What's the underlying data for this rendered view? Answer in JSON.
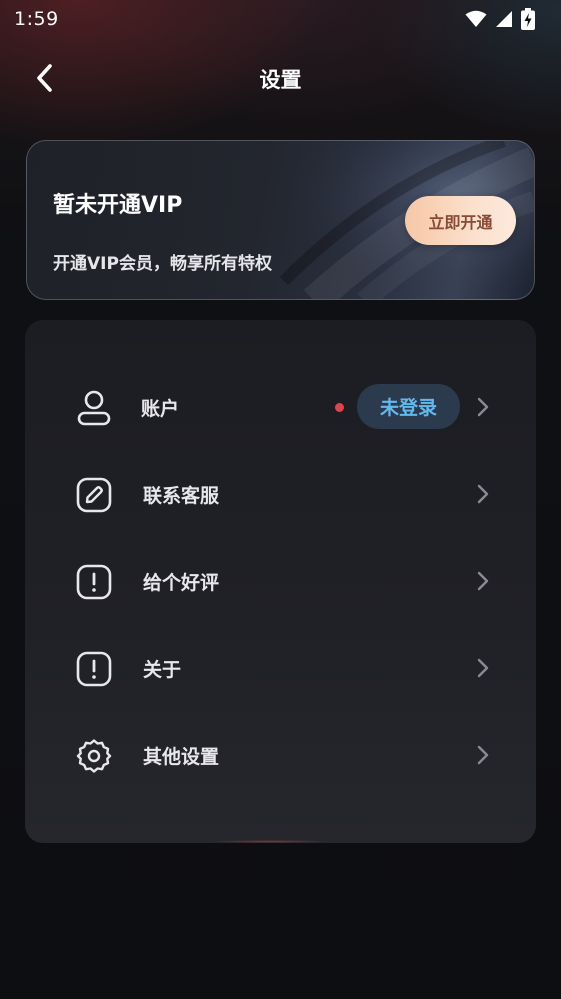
{
  "status_bar": {
    "time": "1:59",
    "icons": [
      "wifi-icon",
      "signal-icon",
      "battery-charging-icon"
    ]
  },
  "header": {
    "title": "设置",
    "back_icon": "back-chevron-icon"
  },
  "vip_card": {
    "title": "暂未开通VIP",
    "subtitle": "开通VIP会员，畅享所有特权",
    "button_label": "立即开通"
  },
  "settings": {
    "items": [
      {
        "label": "账户",
        "icon": "user-icon",
        "badge": "未登录",
        "has_dot": true
      },
      {
        "label": "联系客服",
        "icon": "edit-pencil-icon"
      },
      {
        "label": "给个好评",
        "icon": "exclamation-icon"
      },
      {
        "label": "关于",
        "icon": "exclamation-icon"
      },
      {
        "label": "其他设置",
        "icon": "gear-icon"
      }
    ]
  },
  "colors": {
    "background": "#0d0e12",
    "panel": "#1f2026",
    "badge_bg": "#2b3a4c",
    "badge_text": "#64b9ec",
    "vip_button_bg": "#f8d3ba",
    "vip_button_text": "#8a4a36",
    "red_dot": "#e0434a"
  }
}
